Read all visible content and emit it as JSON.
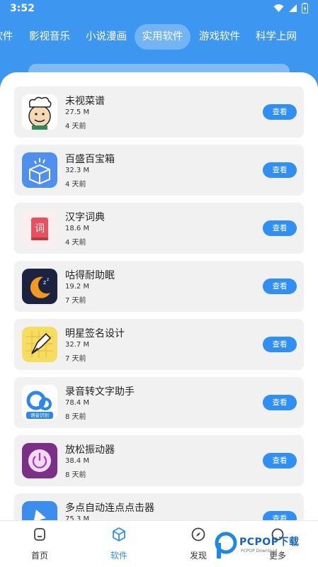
{
  "status_bar": {
    "time": "3:52"
  },
  "tabs": [
    {
      "label": "软件"
    },
    {
      "label": "影视音乐"
    },
    {
      "label": "小说漫画"
    },
    {
      "label": "实用软件",
      "active": true
    },
    {
      "label": "游戏软件"
    },
    {
      "label": "科学上网"
    }
  ],
  "apps": [
    {
      "name": "未视菜谱",
      "size": "27.5 M",
      "time": "4 天前",
      "button": "查看",
      "icon": "chef-icon"
    },
    {
      "name": "百盛百宝箱",
      "size": "32.3 M",
      "time": "4 天前",
      "button": "查看",
      "icon": "toolbox-icon"
    },
    {
      "name": "汉字词典",
      "size": "18.6 M",
      "time": "4 天前",
      "button": "查看",
      "icon": "dictionary-icon"
    },
    {
      "name": "咕得耐助眠",
      "size": "19.2 M",
      "time": "7 天前",
      "button": "查看",
      "icon": "moon-sleep-icon"
    },
    {
      "name": "明星签名设计",
      "size": "32.7 M",
      "time": "7 天前",
      "button": "查看",
      "icon": "pen-icon"
    },
    {
      "name": "录音转文字助手",
      "size": "78.4 M",
      "time": "8 天前",
      "button": "查看",
      "icon": "voice-recognition-icon",
      "icon_caption": "语音识别"
    },
    {
      "name": "放松振动器",
      "size": "38.4 M",
      "time": "8 天前",
      "button": "查看",
      "icon": "power-icon"
    },
    {
      "name": "多点自动连点点击器",
      "size": "75.3 M",
      "time": "",
      "button": "查看",
      "icon": "tap-icon"
    }
  ],
  "bottom_nav": [
    {
      "label": "首页",
      "icon": "home-icon"
    },
    {
      "label": "软件",
      "icon": "software-cube-icon",
      "active": true
    },
    {
      "label": "发现",
      "icon": "compass-icon"
    },
    {
      "label": "更多",
      "icon": "more-icon"
    }
  ],
  "watermark": {
    "text": "PCPOP下载",
    "sub": "PCPOP Download"
  },
  "colors": {
    "header": "#3d97f0",
    "accent": "#2f8ff5",
    "card": "#f1f1f1"
  }
}
